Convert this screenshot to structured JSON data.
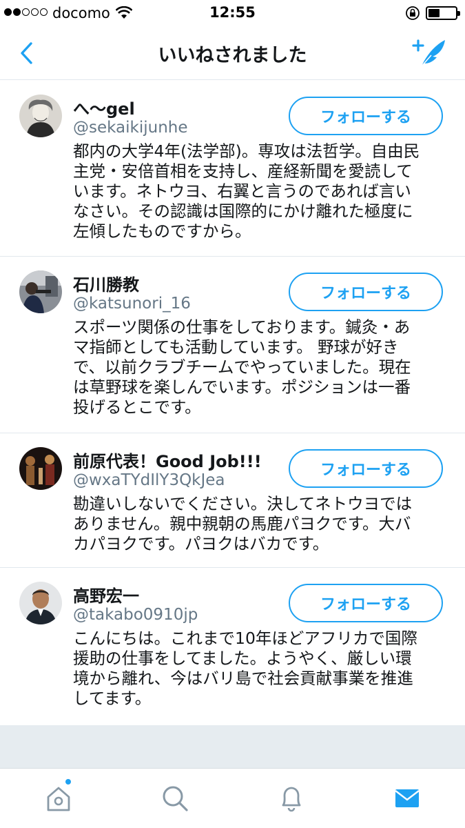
{
  "status": {
    "carrier": "docomo",
    "time": "12:55"
  },
  "nav": {
    "title": "いいねされました"
  },
  "users": [
    {
      "name": "へ〜gel",
      "handle": "@sekaikijunhe",
      "bio_lines": [
        "都内の大学4年(法学部)。専攻は法哲学。自由民",
        "主党・安倍首相を支持し、産経新聞を愛読して",
        "います。ネトウヨ、右翼と言うのであれば言い",
        "なさい。その認識は国際的にかけ離れた極度に",
        "左傾したものですから。"
      ],
      "follow_label": "フォローする"
    },
    {
      "name": "石川勝教",
      "handle": "@katsunori_16",
      "bio_lines": [
        "スポーツ関係の仕事をしております。鍼灸・あ",
        "マ指師としても活動しています。 野球が好き",
        "で、以前クラブチームでやっていました。現在",
        "は草野球を楽しんでいます。ポジションは一番",
        "投げるとこです。"
      ],
      "follow_label": "フォローする"
    },
    {
      "name": "前原代表！Good Job!!!",
      "handle": "@wxaTYdIlY3QkJea",
      "bio_lines": [
        "勘違いしないでください。決してネトウヨでは",
        "ありません。親中親朝の馬鹿パヨクです。大バ",
        "カパヨクです。パヨクはバカです。"
      ],
      "follow_label": "フォローする"
    },
    {
      "name": "高野宏一",
      "handle": "@takabo0910jp",
      "bio_lines": [
        "こんにちは。これまで10年ほどアフリカで国際",
        "援助の仕事をしてました。ようやく、厳しい環",
        "境から離れ、今はバリ島で社会貢献事業を推進",
        "してます。"
      ],
      "follow_label": "フォローする"
    }
  ],
  "tabs": [
    {
      "icon": "home-icon",
      "has_notification_dot": true
    },
    {
      "icon": "search-icon"
    },
    {
      "icon": "bell-icon"
    },
    {
      "icon": "mail-icon",
      "active": true
    }
  ],
  "colors": {
    "accent": "#1da1f2",
    "text": "#14171a",
    "secondary": "#657786",
    "divider": "#e1e8ed",
    "background_gray": "#e6ecf0"
  }
}
